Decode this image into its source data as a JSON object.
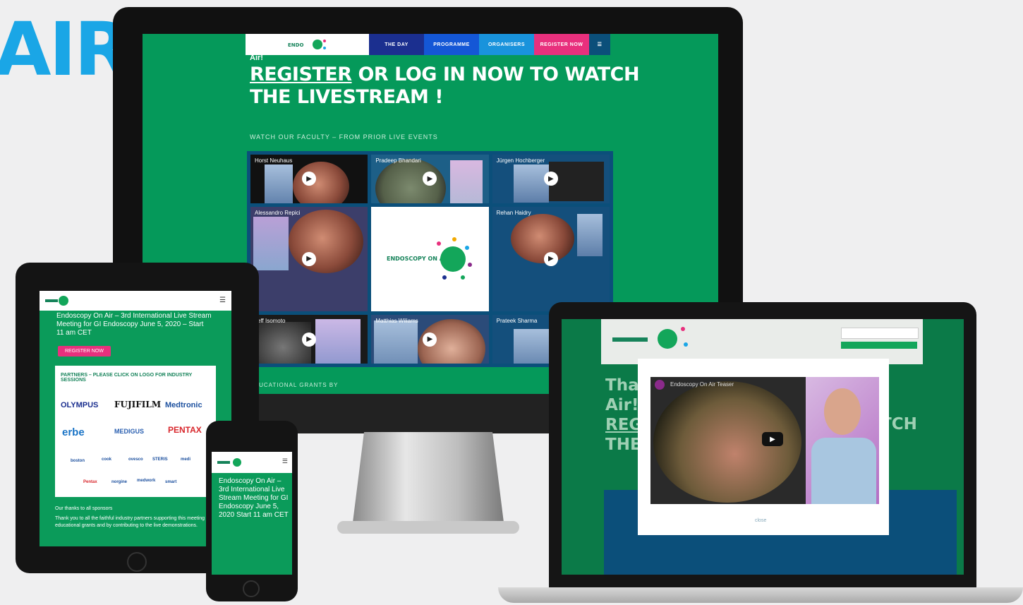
{
  "brand": {
    "partial_text": "AIR"
  },
  "colors": {
    "green": "#05995a",
    "blue": "#1aa6e6",
    "pink": "#e8307d",
    "dark": "#111111"
  },
  "monitor": {
    "nav": [
      {
        "label": "THE DAY",
        "color": "#1b2f8f"
      },
      {
        "label": "PROGRAMME",
        "color": "#1457d6"
      },
      {
        "label": "ORGANISERS",
        "color": "#1993dc"
      },
      {
        "label": "REGISTER NOW",
        "color": "#e8307d"
      }
    ],
    "headline_small": "Air!",
    "headline_register": "REGISTER",
    "headline_rest": " OR LOG IN NOW TO WATCH",
    "headline_line2": "THE LIVESTREAM !",
    "subhead": "WATCH OUR FACULTY – FROM PRIOR LIVE EVENTS",
    "tiles": [
      {
        "title": "Horst Neuhaus",
        "type": "video"
      },
      {
        "title": "Pradeep Bhandari",
        "type": "video"
      },
      {
        "title": "Jürgen Hochberger",
        "type": "video"
      },
      {
        "title": "Alessandro Repici",
        "type": "video"
      },
      {
        "title": "ENDOSCOPY ON AIR",
        "type": "logo"
      },
      {
        "title": "Rehan Haidry",
        "type": "video"
      },
      {
        "title": "Jeff Isomoto",
        "type": "video"
      },
      {
        "title": "Matthias Wiliams",
        "type": "video"
      },
      {
        "title": "Prateek Sharma",
        "type": "video"
      }
    ],
    "footer": "EDUCATIONAL GRANTS BY"
  },
  "tablet": {
    "title": "Endoscopy On Air – 3rd International Live Stream Meeting for GI Endoscopy June 5, 2020 – Start 11 am CET",
    "button": "REGISTER NOW",
    "card_title": "PARTNERS – PLEASE CLICK ON LOGO FOR INDUSTRY SESSIONS",
    "logos_row1": [
      "OLYMPUS",
      "FUJIFILM",
      "Medtronic"
    ],
    "logos_row2": [
      "erbe",
      "MEDIGUS",
      "PENTAX"
    ],
    "logos_row3": [
      "boston",
      "cook",
      "ovesco",
      "STERIS",
      "medi"
    ],
    "logos_row4": [
      "Pentax",
      "norgine",
      "medwork",
      "smart"
    ],
    "footer_title": "Our thanks to all sponsors",
    "footer_text": "Thank you to all the faithful industry partners supporting this meeting with educational grants and by contributing to the live demonstrations."
  },
  "phone": {
    "text": "Endoscopy On Air – 3rd International Live Stream Meeting for GI Endoscopy June 5, 2020 Start 11 am CET"
  },
  "laptop": {
    "big_line1": "Thank",
    "big_line2": "Air!",
    "big_line3": "REG",
    "big_line4": "THE",
    "big_right": "TCH",
    "video_title": "Endoscopy On Air Teaser",
    "modal_close": "close"
  }
}
